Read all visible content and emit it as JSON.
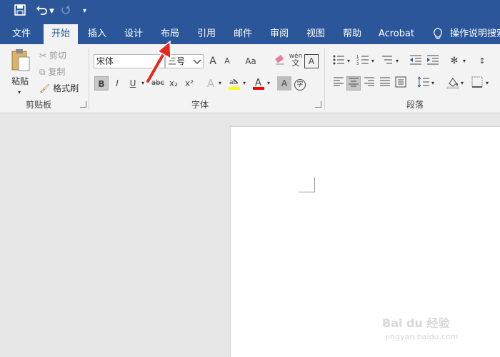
{
  "quick_access": {
    "save": "save-icon",
    "undo": "undo-icon",
    "redo": "redo-icon",
    "customize": "customize-qat-icon"
  },
  "tabs": [
    {
      "label": "文件"
    },
    {
      "label": "开始"
    },
    {
      "label": "插入"
    },
    {
      "label": "设计"
    },
    {
      "label": "布局"
    },
    {
      "label": "引用"
    },
    {
      "label": "邮件"
    },
    {
      "label": "审阅"
    },
    {
      "label": "视图"
    },
    {
      "label": "帮助"
    },
    {
      "label": "Acrobat"
    },
    {
      "label": "操作说明搜索"
    }
  ],
  "clipboard": {
    "paste": "粘贴",
    "cut": "剪切",
    "copy": "复制",
    "format_painter": "格式刷",
    "group_label": "剪贴板"
  },
  "font": {
    "name": "宋体",
    "size": "三号",
    "bold": "B",
    "italic": "I",
    "underline": "U",
    "strikethrough": "abc",
    "subscript": "x₂",
    "superscript": "x²",
    "change_case": "Aa",
    "grow": "A",
    "shrink": "A",
    "phonetic_top": "wén",
    "phonetic_bottom": "文",
    "border_char": "A",
    "shade_char": "A",
    "enclose_char": "字",
    "group_label": "字体"
  },
  "paragraph": {
    "group_label": "段落"
  },
  "watermark": {
    "main": "Bai du 经验",
    "sub": "jingyan.baidu.com"
  },
  "colors": {
    "ribbon_blue": "#2b579a",
    "highlight_yellow": "#ffff00",
    "font_red": "#ff0000",
    "arrow_red": "#e8261c"
  }
}
